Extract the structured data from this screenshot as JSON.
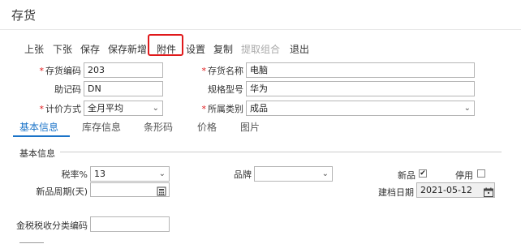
{
  "window": {
    "title": "存货"
  },
  "toolbar": {
    "items": [
      {
        "label": "上张",
        "enabled": true
      },
      {
        "label": "下张",
        "enabled": true
      },
      {
        "label": "保存",
        "enabled": true
      },
      {
        "label": "保存新增",
        "enabled": true
      },
      {
        "label": "附件",
        "enabled": true,
        "highlighted": true
      },
      {
        "label": "设置",
        "enabled": true
      },
      {
        "label": "复制",
        "enabled": true
      },
      {
        "label": "提取组合",
        "enabled": false
      },
      {
        "label": "退出",
        "enabled": true
      }
    ],
    "highlight_color": "#e0191b"
  },
  "form": {
    "code_label": "存货编码",
    "code_value": "203",
    "name_label": "存货名称",
    "name_value": "电脑",
    "mnemonic_label": "助记码",
    "mnemonic_value": "DN",
    "spec_label": "规格型号",
    "spec_value": "华为",
    "costing_label": "计价方式",
    "costing_value": "全月平均",
    "category_label": "所属类别",
    "category_value": "成品"
  },
  "tabs": [
    {
      "label": "基本信息",
      "active": true
    },
    {
      "label": "库存信息",
      "active": false
    },
    {
      "label": "条形码",
      "active": false
    },
    {
      "label": "价格",
      "active": false
    },
    {
      "label": "图片",
      "active": false
    }
  ],
  "accent_color": "#1a73c8",
  "basic": {
    "section_title": "基本信息",
    "tax_label": "税率%",
    "tax_value": "13",
    "brand_label": "品牌",
    "brand_value": "",
    "new_label": "新品",
    "new_checked": true,
    "disabled_label": "停用",
    "disabled_checked": false,
    "cycle_label": "新品周期(天)",
    "cycle_value": "",
    "date_label": "建档日期",
    "date_value": "2021-05-12",
    "tax_code_label": "金税税收分类编码",
    "tax_code_value": ""
  }
}
